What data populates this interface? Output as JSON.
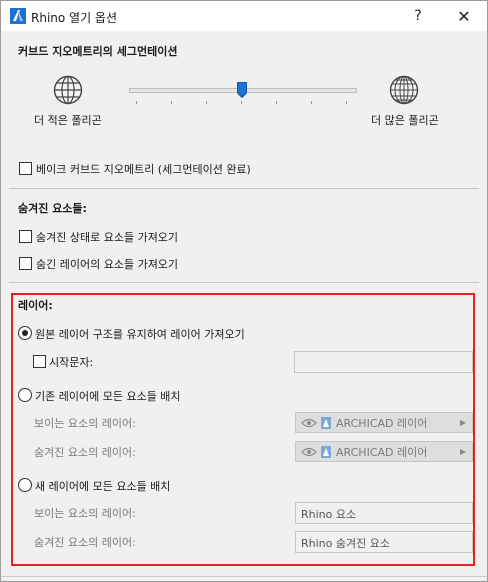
{
  "window": {
    "title": "Rhino 열기 옵션",
    "help_label": "?",
    "close_label": "✕"
  },
  "curved": {
    "heading": "커브드 지오메트리의 세그먼테이션",
    "fewer_label": "더 적은 폴리곤",
    "more_label": "더 많은 폴리곤",
    "slider_level": 0.5,
    "bake_label": "베이크 커브드 지오메트리 (세그먼테이션 완료)",
    "bake_checked": false
  },
  "hidden": {
    "heading": "숨겨진 요소들:",
    "opt1_label": "숨겨진 상태로 요소들 가져오기",
    "opt1_checked": false,
    "opt2_label": "숨긴 레이어의 요소들 가져오기",
    "opt2_checked": false
  },
  "layer": {
    "heading": "레이어:",
    "radio1_label": "원본 레이어 구조를 유지하여 레이어 가져오기",
    "prefix_label": "시작문자:",
    "prefix_value": "",
    "radio2_label": "기존 레이어에 모든 요소들 배치",
    "visible_label": "보이는 요소의 레이어:",
    "hidden_label": "숨겨진 요소의 레이어:",
    "archicad_visible": "ARCHICAD 레이어",
    "archicad_hidden": "ARCHICAD 레이어",
    "radio3_label": "새 레이어에 모든 요소들 배치",
    "new_visible_label": "보이는 요소의 레이어:",
    "new_hidden_label": "숨겨진 요소의 레이어:",
    "new_visible_value": "Rhino 요소",
    "new_hidden_value": "Rhino 숨겨진 요소",
    "selected": 1
  },
  "colors": {
    "highlight_border": "#e0231f",
    "accent": "#1e73d0"
  },
  "icons": [
    "rhino-app-icon",
    "globe-icon",
    "eye-icon",
    "layer-icon",
    "chevron-right-icon"
  ]
}
